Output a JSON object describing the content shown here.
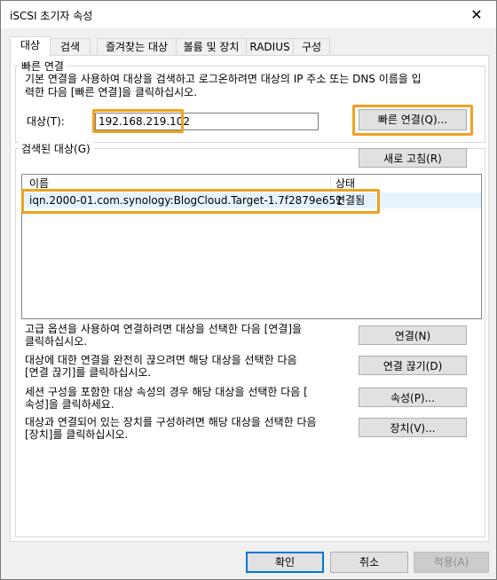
{
  "window": {
    "title": "iSCSI 초기자 속성",
    "close_glyph": "✕"
  },
  "tabs": [
    {
      "label": "대상"
    },
    {
      "label": "검색"
    },
    {
      "label": "즐겨찾는 대상"
    },
    {
      "label": "볼륨 및 장치"
    },
    {
      "label": "RADIUS"
    },
    {
      "label": "구성"
    }
  ],
  "quick_connect": {
    "group_label": "빠른 연결",
    "description_line1": "기본 연결을 사용하여 대상을 검색하고 로그온하려면 대상의 IP 주소 또는 DNS 이름을 입",
    "description_line2": "력한 다음 [빠른 연결]을 클릭하십시오.",
    "target_label": "대상(T):",
    "target_value": "192.168.219.102",
    "button_label": "빠른 연결(Q)..."
  },
  "discovered": {
    "group_label": "검색된 대상(G)",
    "refresh_label": "새로 고침(R)",
    "columns": [
      "이름",
      "상태"
    ],
    "rows": [
      {
        "name": "iqn.2000-01.com.synology:BlogCloud.Target-1.7f2879e651",
        "status": "연결됨"
      }
    ]
  },
  "actions": [
    {
      "text_line1": "고급 옵션을 사용하여 연결하려면 대상을 선택한 다음 [연결]을",
      "text_line2": "클릭하십시오.",
      "button": "연결(N)"
    },
    {
      "text_line1": "대상에 대한 연결을 완전히 끊으려면 해당 대상을 선택한 다음",
      "text_line2": "[연결 끊기]를 클릭하십시오.",
      "button": "연결 끊기(D)"
    },
    {
      "text_line1": "세션 구성을 포함한 대상 속성의 경우 해당 대상을 선택한 다음 [",
      "text_line2": "속성]을 클릭하세요.",
      "button": "속성(P)..."
    },
    {
      "text_line1": "대상과 연결되어 있는 장치를 구성하려면 해당 대상을 선택한 다음",
      "text_line2": "[장치]를 클릭하십시오.",
      "button": "장치(V)..."
    }
  ],
  "footer": {
    "ok": "확인",
    "cancel": "취소",
    "apply": "적용(A)"
  },
  "colors": {
    "highlight": "#f0a21f"
  }
}
